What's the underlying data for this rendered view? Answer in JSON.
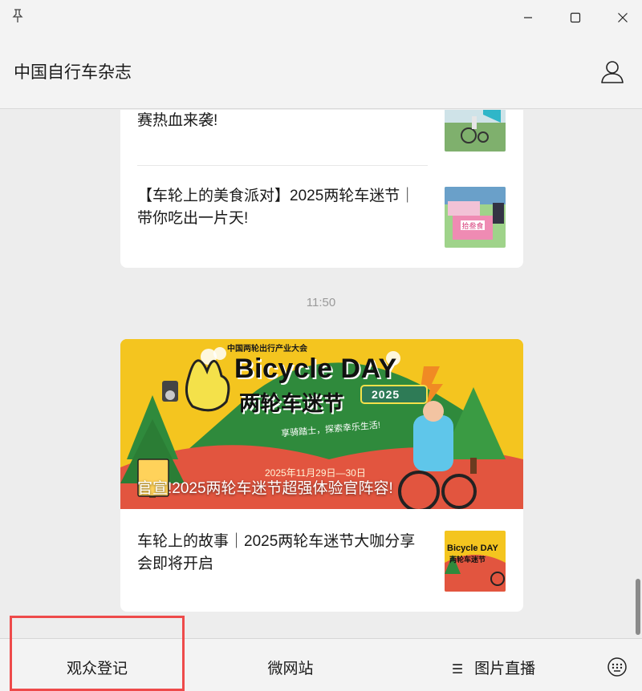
{
  "window": {
    "title": "中国自行车杂志"
  },
  "feed": {
    "card1": {
      "items": [
        {
          "title": "赛热血来袭!"
        },
        {
          "title": "【车轮上的美食派对】2025两轮车迷节｜带你吃出一片天!"
        }
      ]
    },
    "timestamp": "11:50",
    "card2": {
      "banner": {
        "title": "官宣!2025两轮车迷节超强体验官阵容!",
        "art_text": {
          "top": "中国两轮出行产业大会",
          "heading": "Bicycle DAY",
          "sub": "两轮车迷节",
          "year": "2025",
          "slogan": "享骑踏士，探索幸乐生活!",
          "date": "2025年11月29日—30日"
        }
      },
      "items": [
        {
          "title": "车轮上的故事｜2025两轮车迷节大咖分享会即将开启",
          "thumb_text": {
            "heading": "Bicycle DAY",
            "sub": "两轮车迷节"
          }
        }
      ]
    }
  },
  "menu": {
    "items": [
      {
        "label": "观众登记"
      },
      {
        "label": "微网站"
      },
      {
        "label": "图片直播",
        "icon": "☰"
      }
    ]
  },
  "colors": {
    "highlight": "#ee4a4a",
    "banner_yellow": "#f4c51f",
    "banner_green": "#2f8a3c",
    "banner_red": "#e2553f"
  }
}
